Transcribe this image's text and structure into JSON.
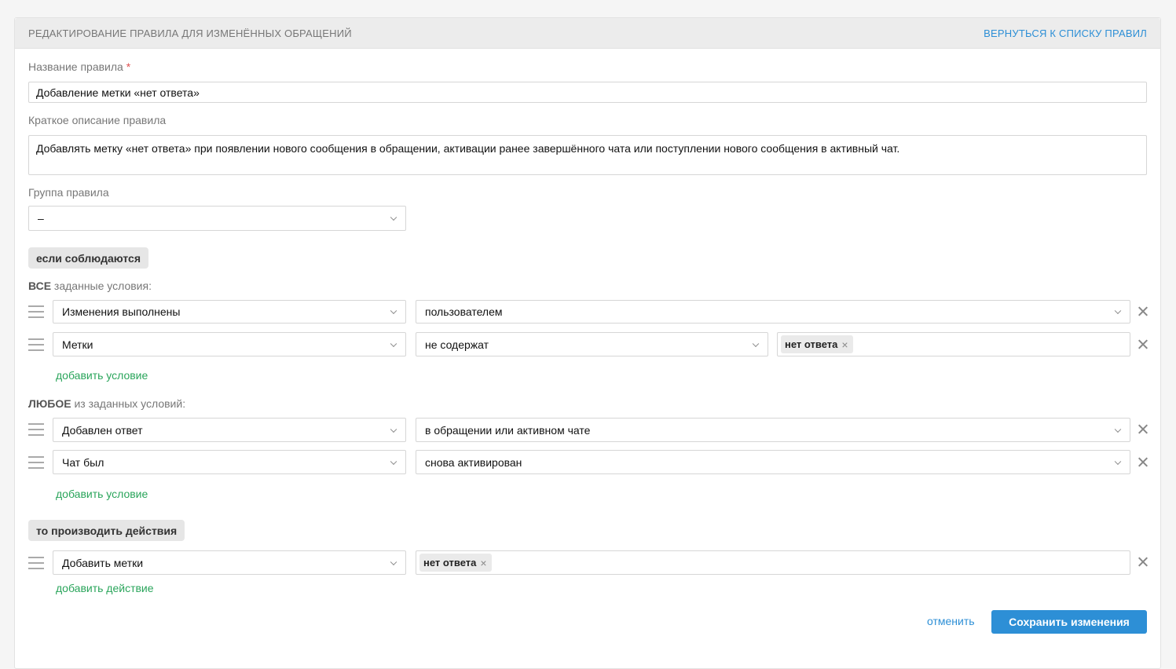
{
  "header": {
    "title": "РЕДАКТИРОВАНИЕ ПРАВИЛА ДЛЯ ИЗМЕНЁННЫХ ОБРАЩЕНИЙ",
    "back_link": "ВЕРНУТЬСЯ К СПИСКУ ПРАВИЛ"
  },
  "form": {
    "name_label": "Название правила",
    "required_mark": "*",
    "name_value": "Добавление метки «нет ответа»",
    "description_label": "Краткое описание правила",
    "description_value": "Добавлять метку «нет ответа» при появлении нового сообщения в обращении, активации ранее завершённого чата или поступлении нового сообщения в активный чат.",
    "group_label": "Группа правила",
    "group_value": "–"
  },
  "conditions": {
    "heading": "если соблюдаются",
    "all": {
      "label_strong": "ВСЕ",
      "label_rest": " заданные условия:",
      "rows": [
        {
          "field": "Изменения выполнены",
          "value": "пользователем"
        },
        {
          "field": "Метки",
          "operator": "не содержат",
          "tag": "нет ответа"
        }
      ],
      "add_label": "добавить условие"
    },
    "any": {
      "label_strong": "ЛЮБОЕ",
      "label_rest": " из заданных условий:",
      "rows": [
        {
          "field": "Добавлен ответ",
          "value": "в обращении или активном чате"
        },
        {
          "field": "Чат был",
          "value": "снова активирован"
        }
      ],
      "add_label": "добавить условие"
    }
  },
  "actions": {
    "heading": "то производить действия",
    "rows": [
      {
        "field": "Добавить метки",
        "tag": "нет ответа"
      }
    ],
    "add_label": "добавить действие"
  },
  "footer": {
    "cancel_label": "отменить",
    "save_label": "Сохранить изменения"
  },
  "icons": {
    "tag_remove": "×"
  }
}
